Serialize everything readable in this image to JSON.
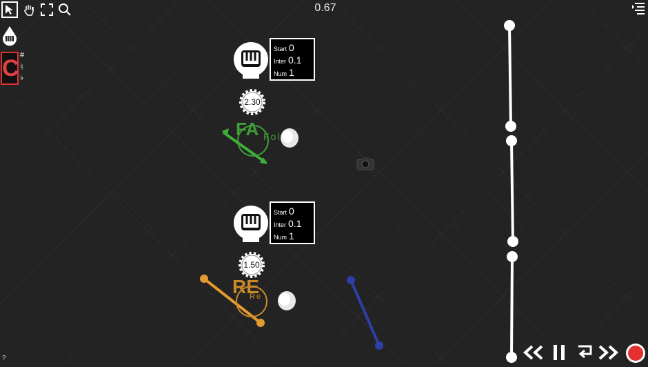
{
  "toolbar": {
    "tools": [
      {
        "name": "select-tool",
        "icon": "arrow-cursor-icon"
      },
      {
        "name": "pan-tool",
        "icon": "hand-icon"
      },
      {
        "name": "fullscreen-tool",
        "icon": "fullscreen-icon"
      },
      {
        "name": "zoom-tool",
        "icon": "magnifier-icon"
      }
    ]
  },
  "timer": "0.67",
  "side_palette": {
    "drop_icon": "drop-piano-icon",
    "note_letter": "C",
    "sharp": "#",
    "natural": "♮",
    "flat": "♭"
  },
  "emitters": [
    {
      "start_label": "Start",
      "start_value": "0",
      "inter_label": "Inter",
      "inter_value": "0.1",
      "num_label": "Num",
      "num_value": "1"
    },
    {
      "start_label": "Start",
      "start_value": "0",
      "inter_label": "Inter",
      "inter_value": "0.1",
      "num_label": "Num",
      "num_value": "1"
    }
  ],
  "gears": [
    {
      "value": "2.30"
    },
    {
      "value": "1.50"
    }
  ],
  "notes": [
    {
      "label": "FA",
      "sub": "Fol",
      "color": "#3f9d3a"
    },
    {
      "label": "RE",
      "sub": "Re",
      "color": "#c98a2a"
    }
  ],
  "lines": {
    "orange": "#e39b2e",
    "blue": "#2f3fa8",
    "green": "#3fae3a"
  },
  "playback": {
    "rewind_icon": "rewind-icon",
    "pause_icon": "pause-icon",
    "loop_icon": "loop-icon",
    "fast_forward_icon": "fast-forward-icon",
    "record_icon": "record-icon",
    "record_color": "#e53030"
  },
  "menu_icon": "menu-list-icon",
  "camera_icon": "camera-icon",
  "help": "?"
}
